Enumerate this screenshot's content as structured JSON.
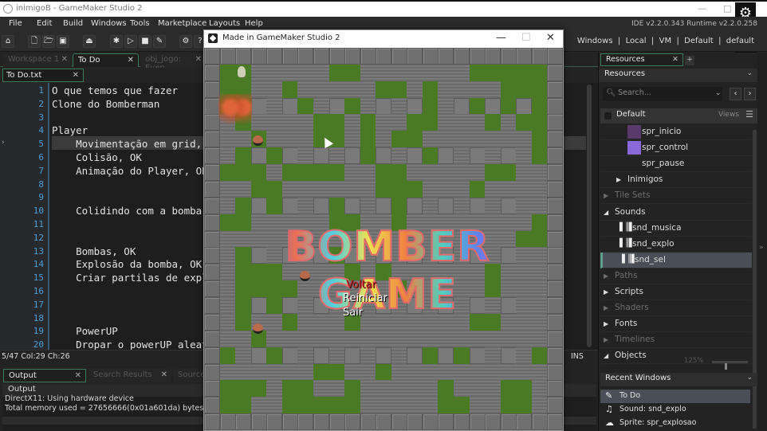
{
  "window": {
    "title": "inimigoB - GameMaker Studio 2",
    "controls": {
      "minimize": "—",
      "maximize": "□"
    }
  },
  "overlay": {
    "settings_icon": "⚙",
    "feedback_icon": "⍰"
  },
  "menubar": {
    "items": [
      "File",
      "Edit",
      "Build",
      "Windows",
      "Tools",
      "Marketplace",
      "Layouts",
      "Help"
    ],
    "version": "IDE v2.2.0.343 Runtime v2.2.0.258"
  },
  "toolbar": {
    "buttons": [
      {
        "name": "home",
        "glyph": "⌂"
      },
      {
        "name": "new-project",
        "glyph": "🗋"
      },
      {
        "name": "open-project",
        "glyph": "🗁"
      },
      {
        "name": "save-project",
        "glyph": "▣"
      },
      {
        "name": "create-executable",
        "glyph": "⏏"
      },
      {
        "name": "debug",
        "glyph": "✱"
      },
      {
        "name": "run",
        "glyph": "▷"
      },
      {
        "name": "stop",
        "glyph": "■"
      },
      {
        "name": "clean",
        "glyph": "✎"
      },
      {
        "name": "game-options",
        "glyph": "⚙"
      },
      {
        "name": "help",
        "glyph": "?"
      }
    ],
    "targets": "Windows  |  Local  |  VM  |  Default  |  default"
  },
  "workspace_tabs": [
    {
      "label": "Workspace 1",
      "active": false
    },
    {
      "label": "To Do",
      "active": true
    },
    {
      "label": "obj_jogo: Even...",
      "active": false
    }
  ],
  "file_tab": {
    "label": "To Do.txt"
  },
  "editor": {
    "lines": [
      {
        "n": "1",
        "text": "O que temos que fazer"
      },
      {
        "n": "2",
        "text": "Clone do Bomberman"
      },
      {
        "n": "3",
        "text": ""
      },
      {
        "n": "4",
        "text": "Player"
      },
      {
        "n": "5",
        "text": "    Movimentação em grid, OK"
      },
      {
        "n": "6",
        "text": "    Colisão, OK"
      },
      {
        "n": "7",
        "text": "    Animação do Player, OK"
      },
      {
        "n": "8",
        "text": ""
      },
      {
        "n": "9",
        "text": ""
      },
      {
        "n": "10",
        "text": "    Colidindo com a bomba, OK"
      },
      {
        "n": "11",
        "text": ""
      },
      {
        "n": "12",
        "text": ""
      },
      {
        "n": "13",
        "text": "    Bombas, OK"
      },
      {
        "n": "14",
        "text": "    Explosão da bomba, OK"
      },
      {
        "n": "15",
        "text": "    Criar partilas de explosão"
      },
      {
        "n": "16",
        "text": ""
      },
      {
        "n": "17",
        "text": ""
      },
      {
        "n": "18",
        "text": ""
      },
      {
        "n": "19",
        "text": "    PowerUP"
      },
      {
        "n": "20",
        "text": "    Dropar o powerUP aleatoriamente"
      }
    ],
    "status_position": "5/47 Col:29 Ch:26",
    "status_mode": "INS"
  },
  "output": {
    "tabs": [
      {
        "label": "Output",
        "active": true
      },
      {
        "label": "Search Results",
        "active": false
      },
      {
        "label": "Source Control",
        "active": false
      }
    ],
    "header": "Output",
    "lines": [
      "DirectX11: Using hardware device",
      "Total memory used = 27656666(0x01a601da) bytes"
    ]
  },
  "game_window": {
    "title": "Made in GameMaker Studio 2",
    "controls": {
      "minimize": "—",
      "maximize": "☐",
      "close": "✕"
    },
    "game_title": "BOMBER GAME",
    "menu_options": [
      {
        "label": "Voltar",
        "selected": true
      },
      {
        "label": "Reiniciar",
        "selected": false
      },
      {
        "label": "Sair",
        "selected": false
      }
    ],
    "map": [
      "WWWWWWWWWWWWWWWWWWWWWWW",
      "WGGbbbbbGGbbbbbbbGGGGGW",
      "WGGbbGbbbbbGGbGbbbbGGGW",
      "WGGBbBGbBGbBbBGbBGBGBGW",
      "WbGbbbbGGbGbbGGbbbGbGGW",
      "WbbGbbbGGbGbGGbbbbbbbGW",
      "WbGBGBbBbBGBbBGBbBbBbGW",
      "WGGGbGGGGbbGGbbbbbGGbbW",
      "WbbGGbbbbbbGGGbbbGbbbbW",
      "WbGBGBbBGBbBGBbBbBbBbbW",
      "WGGbbbbbGGbbGbbbbbbbbGW",
      "WbbbbbbbbbbbbbbbbbbbGGW",
      "WbGBbBbBGBbBbBbBbBbBbbW",
      "WbGGGbbbbGbGbbbbbbGbbbW",
      "WbGGGGbbbbbbGbbbbbGbbbW",
      "WbGBGBbBbBbBbBbBbBbBbbW",
      "WbGbbGbbbGbbbbbbbGGbbbW",
      "WbbGbbbbbbbbbbbbbbbbbbW",
      "WGbBGBbBbBbBbBGBGBbBbGW",
      "WbbbbbbGGbbGbbbbbbbbbbW",
      "WGGGbGGbbGbbbbbGbbbGGbW",
      "WGGbbGGGGGbbbbbGGbbGGbW",
      "WWWWWWWWWWWWWWWWWWWWWWW"
    ],
    "tile_legend": {
      "W": "wall",
      "b": "brick",
      "G": "grass",
      "B": "block"
    },
    "colors": {
      "grass": "#4a7a24",
      "wall": "#707070",
      "selected_option": "#c0282a"
    }
  },
  "resources": {
    "tab_label": "Resources",
    "add_label": "+",
    "header": "Resources",
    "search_placeholder": "Search...",
    "nav_prev": "‹",
    "nav_next": "›",
    "group": "Default",
    "views_label": "Views",
    "tree": [
      {
        "label": "spr_inicio",
        "type": "sprite",
        "indent": 2,
        "thumb": "#5a3a6a"
      },
      {
        "label": "spr_control",
        "type": "sprite",
        "indent": 2,
        "thumb": "#8a6ad8"
      },
      {
        "label": "spr_pause",
        "type": "sprite",
        "indent": 2,
        "thumb": ""
      },
      {
        "label": "Inimigos",
        "type": "folder",
        "indent": 1,
        "expanded": false
      },
      {
        "label": "Tile Sets",
        "type": "category",
        "indent": 0,
        "expanded": false,
        "dim": true
      },
      {
        "label": "Sounds",
        "type": "category",
        "indent": 0,
        "expanded": true
      },
      {
        "label": "snd_musica",
        "type": "sound",
        "indent": 1
      },
      {
        "label": "snd_explo",
        "type": "sound",
        "indent": 1
      },
      {
        "label": "snd_sel",
        "type": "sound",
        "indent": 1,
        "selected": true
      },
      {
        "label": "Paths",
        "type": "category",
        "indent": 0,
        "expanded": false,
        "dim": true
      },
      {
        "label": "Scripts",
        "type": "category",
        "indent": 0,
        "expanded": false
      },
      {
        "label": "Shaders",
        "type": "category",
        "indent": 0,
        "expanded": false,
        "dim": true
      },
      {
        "label": "Fonts",
        "type": "category",
        "indent": 0,
        "expanded": false
      },
      {
        "label": "Timelines",
        "type": "category",
        "indent": 0,
        "expanded": false,
        "dim": true
      },
      {
        "label": "Objects",
        "type": "category",
        "indent": 0,
        "expanded": true
      }
    ],
    "zoom_label": "125%",
    "zoom_value": 0.35,
    "recent_header": "Recent Windows",
    "recent": [
      {
        "label": "To Do",
        "icon": "✎",
        "selected": true
      },
      {
        "label": "Sound: snd_explo",
        "icon": "♫",
        "selected": false
      },
      {
        "label": "Sprite: spr_explosao",
        "icon": "☁",
        "selected": false
      }
    ]
  }
}
